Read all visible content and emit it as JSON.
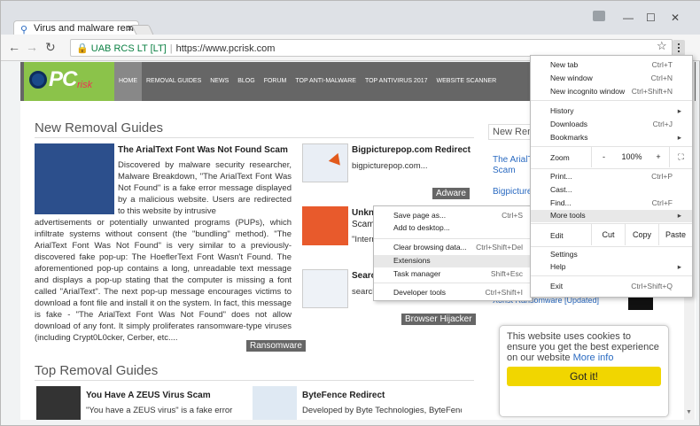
{
  "browser": {
    "tab_title": "Virus and malware remo",
    "address_security": "UAB RCS LT [LT]",
    "address_url": "https://www.pcrisk.com",
    "win_min": "—",
    "win_max": "☐",
    "win_close": "✕"
  },
  "site": {
    "logo_text": "PC",
    "logo_sub": "risk",
    "nav": [
      "HOME",
      "REMOVAL GUIDES",
      "NEWS",
      "BLOG",
      "FORUM",
      "TOP ANTI-MALWARE",
      "TOP ANTIVIRUS 2017",
      "WEBSITE SCANNER"
    ],
    "section1": "New Removal Guides",
    "section2": "Top Removal Guides",
    "side_heading": "New Remo",
    "article1": {
      "title": "The ArialText Font Was Not Found Scam",
      "body_top": "Discovered by malware security researcher, Malware Breakdown, \"The ArialText Font Was Not Found\" is a fake error message displayed by a malicious website. Users are redirected to this website by intrusive",
      "body_full": "advertisements or potentially unwanted programs (PUPs), which infiltrate systems without consent (the \"bundling\" method). \"The ArialText Font Was Not Found\" is very similar to a previously-discovered fake pop-up: The HoeflerText Font Wasn't Found. The aforementioned pop-up contains a long, unreadable text message and displays a pop-up stating that the computer is missing a font called \"ArialText\". The next pop-up message encourages victims to download a font file and install it on the system. In fact, this message is fake - \"The ArialText Font Was Not Found\" does not allow download of any font. It simply proliferates ransomware-type viruses (including Crypt0L0cker, Cerber, etc....",
      "tag": "Ransomware"
    },
    "article2": {
      "title": "Bigpicturepop.com Redirect",
      "body": "bigpicturepop.com...",
      "tag": "Adware"
    },
    "article3": {
      "title": "Unkno",
      "sub": "Scam",
      "body": "\"Intern"
    },
    "article4": {
      "title": "Searc",
      "body": "search",
      "tag": "Browser Hijacker"
    },
    "side_links": [
      "The ArialTe",
      "Scam",
      "Bigpicturep",
      "Xorist Ransomware [Updated]"
    ],
    "top1": {
      "title": "You Have A ZEUS Virus Scam",
      "body": "\"You have a ZEUS virus\" is a fake error"
    },
    "top2": {
      "title": "ByteFence Redirect",
      "body": "Developed by Byte Technologies, ByteFence"
    }
  },
  "cookie": {
    "text": "This website uses cookies to ensure you get the best experience on our website",
    "more": "More info",
    "button": "Got it!"
  },
  "context_menu": [
    {
      "label": "Save page as...",
      "key": "Ctrl+S"
    },
    {
      "label": "Add to desktop...",
      "key": ""
    },
    {
      "label": "Clear browsing data...",
      "key": "Ctrl+Shift+Del"
    },
    {
      "label": "Extensions",
      "key": ""
    },
    {
      "label": "Task manager",
      "key": "Shift+Esc"
    },
    {
      "label": "Developer tools",
      "key": "Ctrl+Shift+I"
    }
  ],
  "chrome_menu": {
    "items": [
      {
        "label": "New tab",
        "key": "Ctrl+T"
      },
      {
        "label": "New window",
        "key": "Ctrl+N"
      },
      {
        "label": "New incognito window",
        "key": "Ctrl+Shift+N"
      },
      {
        "label": "History",
        "key": ""
      },
      {
        "label": "Downloads",
        "key": "Ctrl+J"
      },
      {
        "label": "Bookmarks",
        "key": ""
      },
      {
        "label": "Print...",
        "key": "Ctrl+P"
      },
      {
        "label": "Cast...",
        "key": ""
      },
      {
        "label": "Find...",
        "key": "Ctrl+F"
      },
      {
        "label": "More tools",
        "key": ""
      },
      {
        "label": "Settings",
        "key": ""
      },
      {
        "label": "Help",
        "key": ""
      },
      {
        "label": "Exit",
        "key": "Ctrl+Shift+Q"
      }
    ],
    "zoom_label": "Zoom",
    "zoom_minus": "-",
    "zoom_value": "100%",
    "zoom_plus": "+",
    "edit_label": "Edit",
    "cut": "Cut",
    "copy": "Copy",
    "paste": "Paste",
    "arrow": "▸"
  }
}
